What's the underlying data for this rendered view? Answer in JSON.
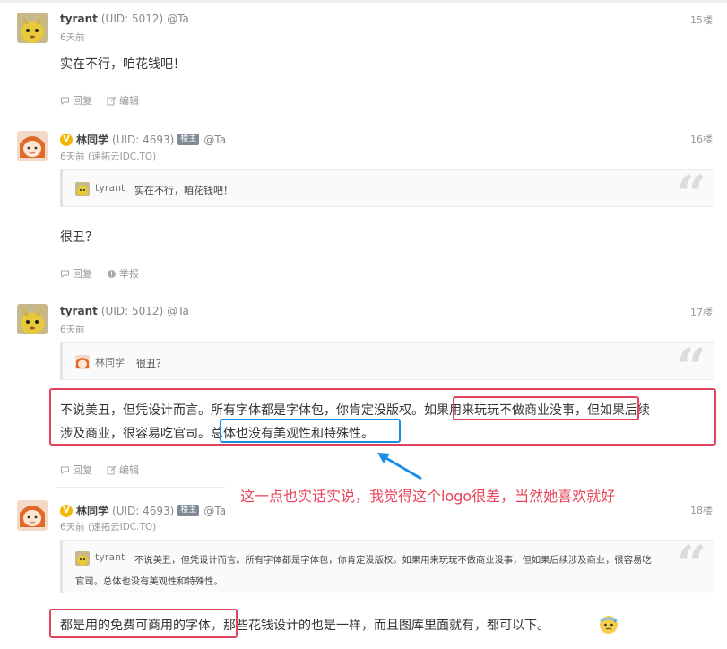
{
  "posts": [
    {
      "username": "tyrant",
      "uid": "(UID: 5012)",
      "ta": "@Ta",
      "time": "6天前",
      "floor": "15楼",
      "content": "实在不行，咱花钱吧！",
      "reply": "回复",
      "second_action": "编辑"
    },
    {
      "username": "林同学",
      "uid": "(UID: 4693)",
      "owner_badge": "楼主",
      "ta": "@Ta",
      "time": "6天前 (速拓云IDC.TO)",
      "floor": "16楼",
      "quote_user": "tyrant",
      "quote_text": "实在不行，咱花钱吧！",
      "content": "很丑？",
      "reply": "回复",
      "second_action": "举报"
    },
    {
      "username": "tyrant",
      "uid": "(UID: 5012)",
      "ta": "@Ta",
      "time": "6天前",
      "floor": "17楼",
      "quote_user": "林同学",
      "quote_text": "很丑？",
      "content_line1": "不说美丑，但凭设计而言。所有字体都是字体包，你肯定没版权。如果用来玩玩不做商业没事，但如果后续",
      "content_line2": "涉及商业，很容易吃官司。总体也没有美观性和特殊性。",
      "reply": "回复",
      "second_action": "编辑"
    },
    {
      "username": "林同学",
      "uid": "(UID: 4693)",
      "owner_badge": "楼主",
      "ta": "@Ta",
      "time": "6天前 (速拓云IDC.TO)",
      "floor": "18楼",
      "quote_user": "tyrant",
      "quote_line1": "不说美丑，但凭设计而言。所有字体都是字体包，你肯定没版权。如果用来玩玩不做商业没事，但如果后续涉及商业，很容易吃",
      "quote_line2": "官司。总体也没有美观性和特殊性。",
      "content": "都是用的免费可商用的字体，那些花钱设计的也是一样，而且图库里面就有，都可以下。"
    }
  ],
  "annotation": "这一点也实话实说，我觉得这个logo很差，当然她喜欢就好",
  "colors": {
    "highlight_red": "#e0445d",
    "highlight_blue": "#1a8ee6",
    "annotation": "#e8455b"
  }
}
